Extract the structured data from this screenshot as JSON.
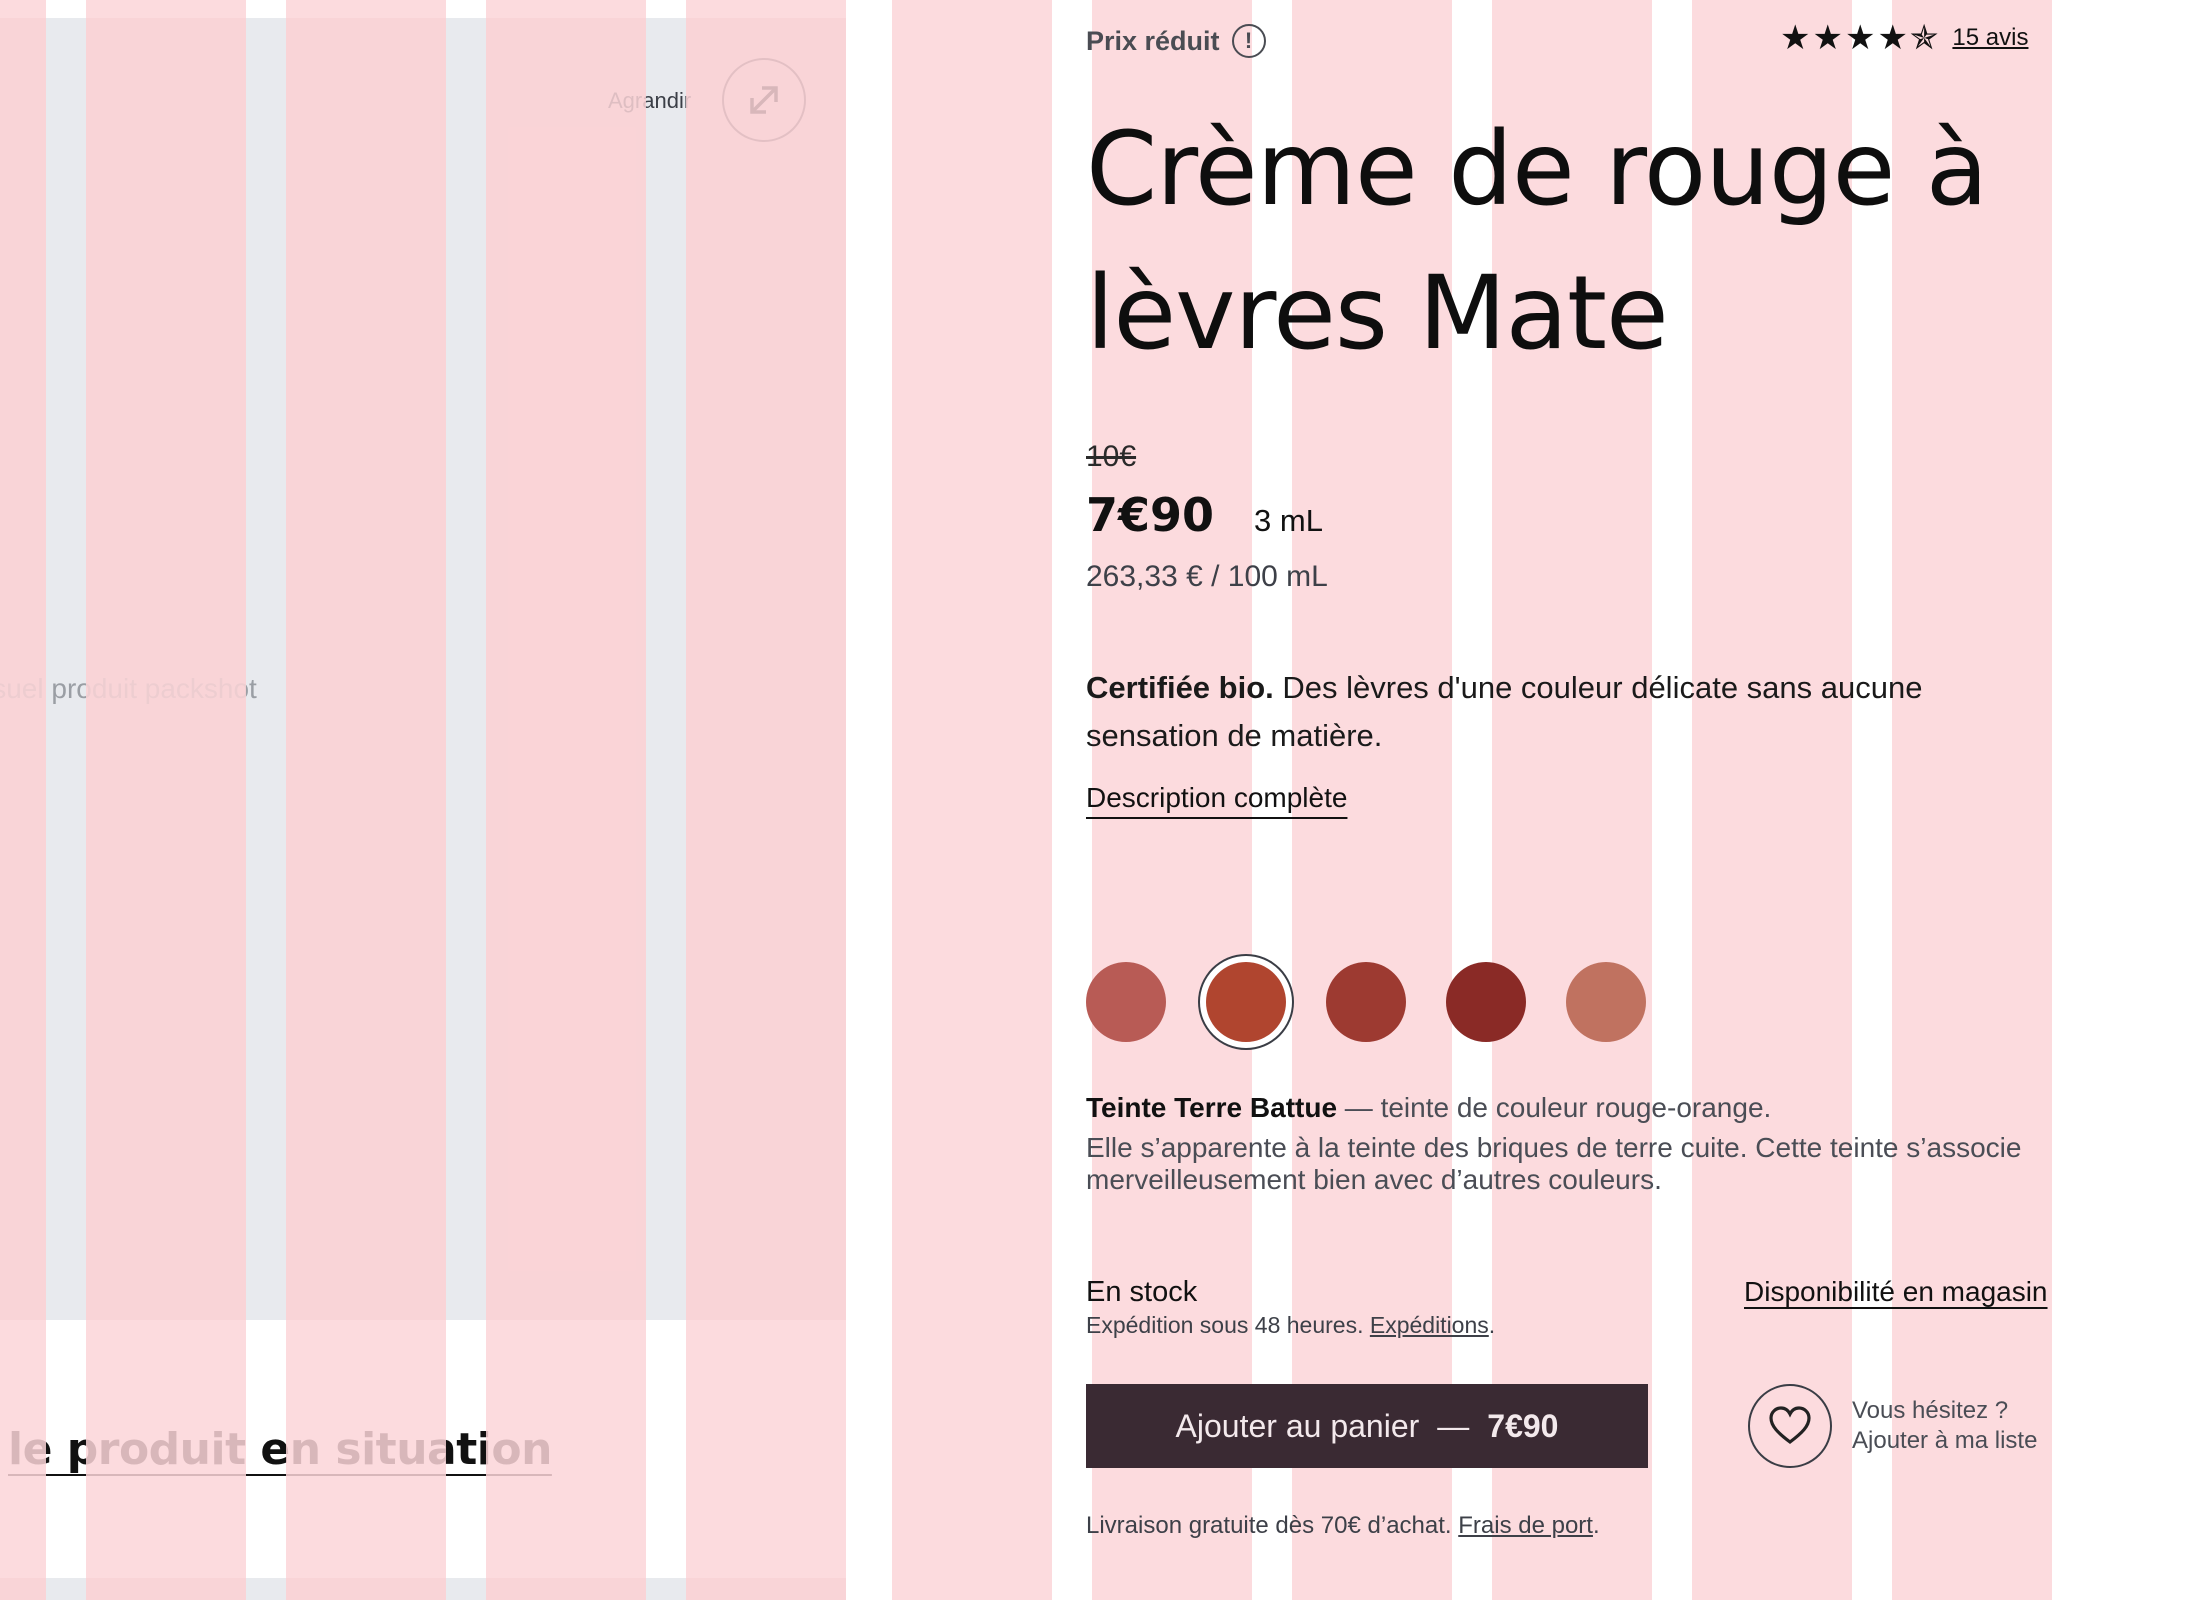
{
  "media": {
    "packshot_label": "isuel produit packshot",
    "zoom_label": "Agrandir",
    "zoom_icon": "expand-arrows-icon",
    "situation_link": "le produit en situation"
  },
  "header": {
    "discount_label": "Prix réduit",
    "info_icon_glyph": "!",
    "stars": "★★★★✯",
    "rating_value": 4.5,
    "reviews_link": "15 avis"
  },
  "product": {
    "title": "Crème de rouge à lèvres Mate",
    "old_price": "10€",
    "price": "7€90",
    "volume": "3 mL",
    "unit_price": "263,33 € / 100 mL",
    "description_bold": "Certifiée bio.",
    "description_text": " Des lèvres d'une couleur délicate sans aucune sensation de matière.",
    "full_description_link": "Description complète"
  },
  "shades": {
    "swatches": [
      "#b85b55",
      "#b0452f",
      "#9d3a31",
      "#8a2a26",
      "#c07260"
    ],
    "selected_index": 1,
    "selected_name": "Teinte Terre Battue",
    "selected_summary": " — teinte de couleur rouge-orange.",
    "selected_detail": "Elle s’apparente à la teinte des briques de terre cuite. Cette teinte s’associe merveilleusement bien avec d’autres couleurs."
  },
  "availability": {
    "stock": "En stock",
    "shipping_text": "Expédition sous 48 heures. ",
    "shipping_link": "Expéditions",
    "shipping_end": ".",
    "store_link": "Disponibilité en magasin"
  },
  "purchase": {
    "cart_label": "Ajouter au panier",
    "cart_separator": "—",
    "cart_price": "7€90",
    "wish_icon": "heart-icon",
    "wish_line1": "Vous hésitez ?",
    "wish_line2": "Ajouter à ma liste",
    "free_shipping_text": "Livraison gratuite dès 70€ d’achat. ",
    "free_shipping_link": "Frais de port",
    "free_shipping_end": "."
  },
  "colors": {
    "grid_overlay": "#fcd5d8",
    "cart_button_bg": "#3a2a33"
  }
}
